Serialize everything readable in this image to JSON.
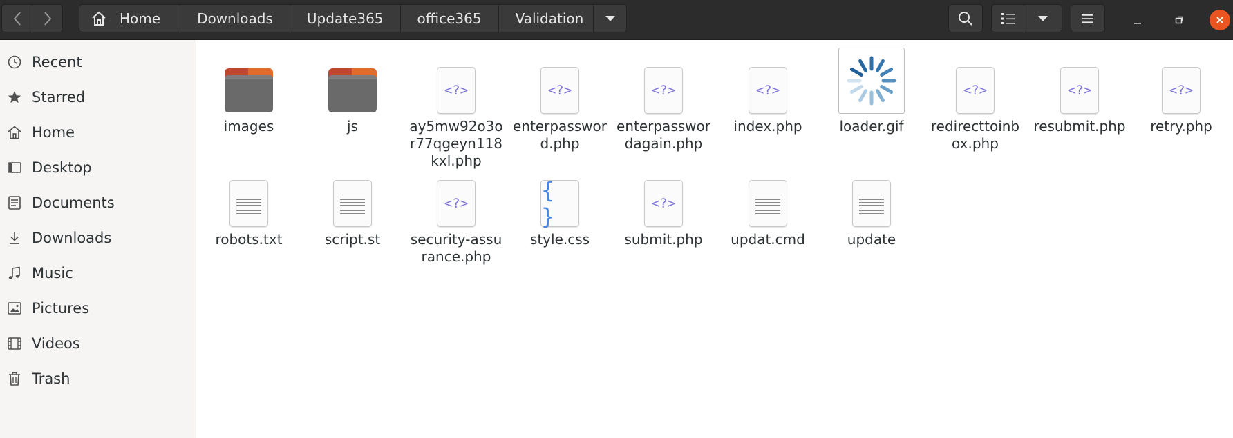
{
  "header": {
    "breadcrumbs": [
      "Home",
      "Downloads",
      "Update365",
      "office365",
      "Validation"
    ],
    "icons": {
      "back": "chevron-left-icon",
      "forward": "chevron-right-icon",
      "home": "home-icon",
      "path_menu": "caret-down-icon",
      "search": "search-icon",
      "list_view": "list-view-icon",
      "view_options": "caret-down-icon",
      "main_menu": "hamburger-icon",
      "minimize": "minimize-icon",
      "maximize": "maximize-icon",
      "close": "close-icon"
    }
  },
  "sidebar": {
    "items": [
      {
        "label": "Recent",
        "icon": "clock-icon"
      },
      {
        "label": "Starred",
        "icon": "star-icon"
      },
      {
        "label": "Home",
        "icon": "home-icon"
      },
      {
        "label": "Desktop",
        "icon": "desktop-icon"
      },
      {
        "label": "Documents",
        "icon": "document-icon"
      },
      {
        "label": "Downloads",
        "icon": "download-icon"
      },
      {
        "label": "Music",
        "icon": "music-icon"
      },
      {
        "label": "Pictures",
        "icon": "picture-icon"
      },
      {
        "label": "Videos",
        "icon": "video-icon"
      },
      {
        "label": "Trash",
        "icon": "trash-icon"
      }
    ]
  },
  "files": [
    {
      "name": "images",
      "kind": "folder"
    },
    {
      "name": "js",
      "kind": "folder"
    },
    {
      "name": "ay5mw92o3or77qgeyn118kxl.php",
      "kind": "php"
    },
    {
      "name": "enterpassword.php",
      "kind": "php"
    },
    {
      "name": "enterpasswordagain.php",
      "kind": "php"
    },
    {
      "name": "index.php",
      "kind": "php"
    },
    {
      "name": "loader.gif",
      "kind": "gif"
    },
    {
      "name": "redirecttoinbox.php",
      "kind": "php"
    },
    {
      "name": "resubmit.php",
      "kind": "php"
    },
    {
      "name": "retry.php",
      "kind": "php"
    },
    {
      "name": "robots.txt",
      "kind": "text"
    },
    {
      "name": "script.st",
      "kind": "text"
    },
    {
      "name": "security-assurance.php",
      "kind": "php"
    },
    {
      "name": "style.css",
      "kind": "css"
    },
    {
      "name": "submit.php",
      "kind": "php"
    },
    {
      "name": "updat.cmd",
      "kind": "text"
    },
    {
      "name": "update",
      "kind": "text"
    }
  ],
  "colors": {
    "headerbar": "#2c2c2c",
    "sidebar": "#f6f5f4",
    "folder": "#6a6a6a",
    "folder_tab": "#e36c2d",
    "php_glyph": "#7f76d8",
    "css_glyph": "#4a86e8",
    "close_button": "#e95420"
  }
}
